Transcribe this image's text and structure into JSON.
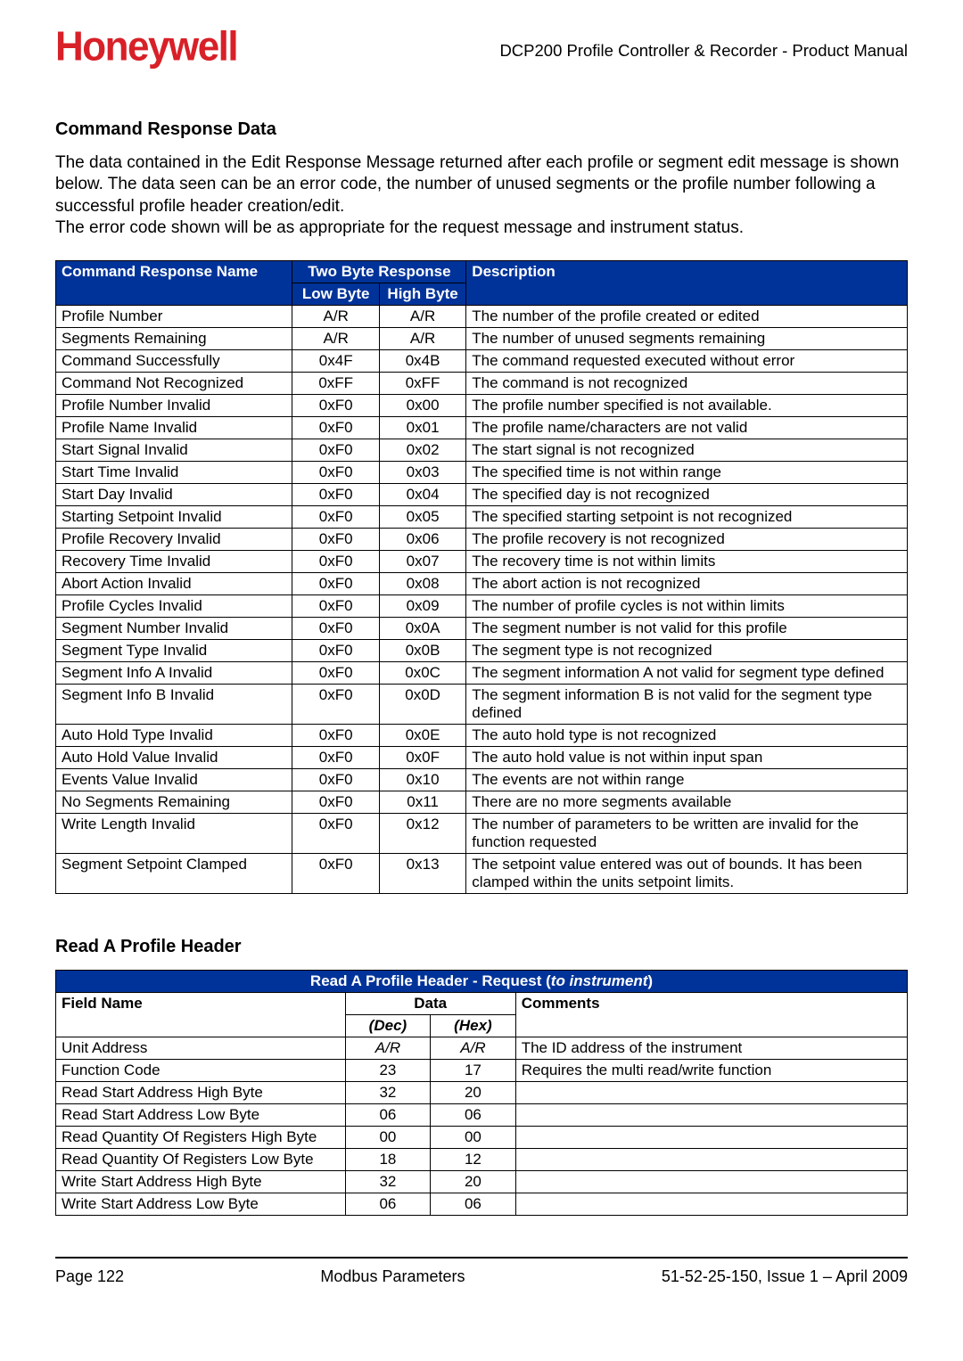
{
  "header": {
    "logo": "Honeywell",
    "doc_title": "DCP200 Profile Controller & Recorder - Product Manual"
  },
  "section1": {
    "heading": "Command Response Data",
    "paragraph": "The data contained in the Edit Response Message returned after each profile or segment edit message is shown below. The data seen can be an error code, the number of unused segments or the profile number following a successful profile header creation/edit.\nThe error code shown will be as appropriate for the request message and instrument status."
  },
  "table1": {
    "head": {
      "name": "Command Response Name",
      "two_byte": "Two Byte Response",
      "low": "Low Byte",
      "high": "High Byte",
      "desc": "Description"
    },
    "rows": [
      {
        "name": "Profile Number",
        "low": "A/R",
        "high": "A/R",
        "desc": "The number of the profile created or edited"
      },
      {
        "name": "Segments Remaining",
        "low": "A/R",
        "high": "A/R",
        "desc": "The number of unused segments remaining"
      },
      {
        "name": "Command Successfully",
        "low": "0x4F",
        "high": "0x4B",
        "desc": "The command requested executed without error"
      },
      {
        "name": "Command Not Recognized",
        "low": "0xFF",
        "high": "0xFF",
        "desc": "The command is not recognized"
      },
      {
        "name": "Profile Number Invalid",
        "low": "0xF0",
        "high": "0x00",
        "desc": "The profile number specified is not available."
      },
      {
        "name": "Profile Name Invalid",
        "low": "0xF0",
        "high": "0x01",
        "desc": "The profile name/characters are not valid"
      },
      {
        "name": "Start Signal Invalid",
        "low": "0xF0",
        "high": "0x02",
        "desc": "The start signal is not recognized"
      },
      {
        "name": "Start Time Invalid",
        "low": "0xF0",
        "high": "0x03",
        "desc": "The specified time is not within range"
      },
      {
        "name": "Start Day Invalid",
        "low": "0xF0",
        "high": "0x04",
        "desc": "The specified day is not recognized"
      },
      {
        "name": "Starting Setpoint Invalid",
        "low": "0xF0",
        "high": "0x05",
        "desc": "The specified starting setpoint is not recognized"
      },
      {
        "name": "Profile Recovery Invalid",
        "low": "0xF0",
        "high": "0x06",
        "desc": "The profile recovery is not recognized"
      },
      {
        "name": "Recovery Time Invalid",
        "low": "0xF0",
        "high": "0x07",
        "desc": "The recovery time is not within limits"
      },
      {
        "name": "Abort Action Invalid",
        "low": "0xF0",
        "high": "0x08",
        "desc": "The abort action is not recognized"
      },
      {
        "name": "Profile Cycles Invalid",
        "low": "0xF0",
        "high": "0x09",
        "desc": "The number of profile cycles is not within limits"
      },
      {
        "name": "Segment Number Invalid",
        "low": "0xF0",
        "high": "0x0A",
        "desc": "The segment number is not valid for this profile"
      },
      {
        "name": "Segment Type Invalid",
        "low": "0xF0",
        "high": "0x0B",
        "desc": "The segment type is not recognized"
      },
      {
        "name": "Segment Info A Invalid",
        "low": "0xF0",
        "high": "0x0C",
        "desc": "The segment information A not valid for segment type defined"
      },
      {
        "name": "Segment Info B Invalid",
        "low": "0xF0",
        "high": "0x0D",
        "desc": "The segment information B is not valid for the segment type defined"
      },
      {
        "name": "Auto Hold Type Invalid",
        "low": "0xF0",
        "high": "0x0E",
        "desc": "The auto hold type is not recognized"
      },
      {
        "name": "Auto Hold Value Invalid",
        "low": "0xF0",
        "high": "0x0F",
        "desc": "The auto hold value is not within input span"
      },
      {
        "name": "Events Value Invalid",
        "low": "0xF0",
        "high": "0x10",
        "desc": "The events are not within range"
      },
      {
        "name": "No Segments Remaining",
        "low": "0xF0",
        "high": "0x11",
        "desc": "There are no more segments available"
      },
      {
        "name": "Write Length Invalid",
        "low": "0xF0",
        "high": "0x12",
        "desc": "The number of parameters to be written are invalid for the function requested"
      },
      {
        "name": "Segment Setpoint Clamped",
        "low": "0xF0",
        "high": "0x13",
        "desc": "The setpoint value entered was out of bounds. It has been clamped within the units setpoint limits."
      }
    ]
  },
  "section2": {
    "heading": "Read A Profile Header"
  },
  "table2": {
    "title_pre": "Read A Profile Header - Request (",
    "title_ital": "to instrument",
    "title_post": ")",
    "head": {
      "field": "Field Name",
      "data": "Data",
      "dec": "(Dec)",
      "hex": "(Hex)",
      "comments": "Comments"
    },
    "rows": [
      {
        "field": "Unit Address",
        "dec": "A/R",
        "hex": "A/R",
        "ital": true,
        "comments": "The ID address of the instrument"
      },
      {
        "field": "Function Code",
        "dec": "23",
        "hex": "17",
        "ital": false,
        "comments": "Requires the multi read/write function"
      },
      {
        "field": "Read Start Address High Byte",
        "dec": "32",
        "hex": "20",
        "ital": false,
        "comments": ""
      },
      {
        "field": "Read Start Address Low Byte",
        "dec": "06",
        "hex": "06",
        "ital": false,
        "comments": ""
      },
      {
        "field": "Read Quantity Of Registers High Byte",
        "dec": "00",
        "hex": "00",
        "ital": false,
        "comments": ""
      },
      {
        "field": "Read Quantity Of Registers Low Byte",
        "dec": "18",
        "hex": "12",
        "ital": false,
        "comments": ""
      },
      {
        "field": "Write Start Address High Byte",
        "dec": "32",
        "hex": "20",
        "ital": false,
        "comments": ""
      },
      {
        "field": "Write Start Address Low Byte",
        "dec": "06",
        "hex": "06",
        "ital": false,
        "comments": ""
      }
    ]
  },
  "footer": {
    "left": "Page 122",
    "center": "Modbus Parameters",
    "right": "51-52-25-150, Issue 1 – April 2009"
  }
}
